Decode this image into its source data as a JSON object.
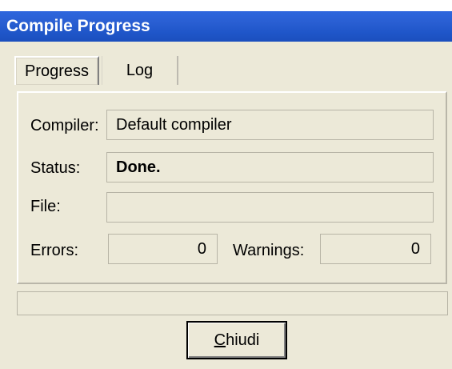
{
  "window": {
    "title": "Compile Progress"
  },
  "tabs": [
    {
      "label": "Progress",
      "selected": true
    },
    {
      "label": "Log",
      "selected": false
    }
  ],
  "fields": {
    "compiler": {
      "label": "Compiler:",
      "value": "Default compiler"
    },
    "status": {
      "label": "Status:",
      "value": "Done."
    },
    "file": {
      "label": "File:",
      "value": ""
    },
    "errors": {
      "label": "Errors:",
      "value": "0"
    },
    "warnings": {
      "label": "Warnings:",
      "value": "0"
    }
  },
  "progress": {
    "percent": 0
  },
  "buttons": {
    "close": {
      "accel": "C",
      "rest": "hiudi"
    }
  },
  "colors": {
    "titlebar": "#2A5FD3",
    "window_bg": "#ECE9D8",
    "title_text": "#FFFFFF"
  }
}
